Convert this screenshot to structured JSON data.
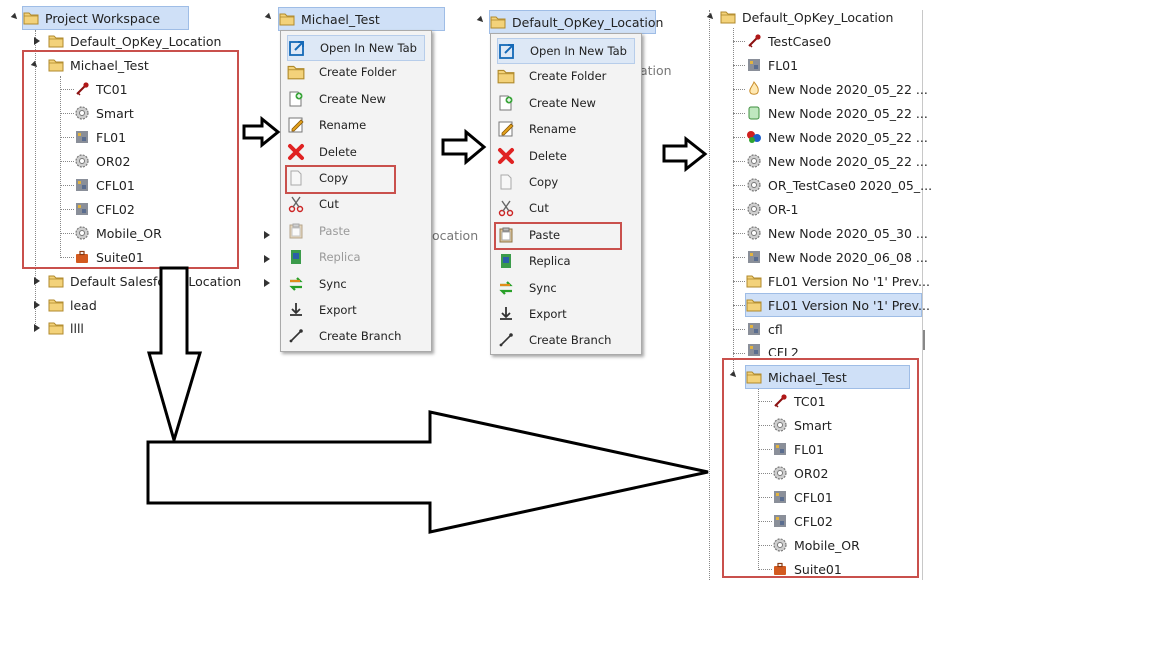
{
  "panel1": {
    "root": "Project Workspace",
    "items": [
      "Default_OpKey_Location",
      "Michael_Test"
    ],
    "children": [
      "TC01",
      "Smart",
      "FL01",
      "OR02",
      "CFL01",
      "CFL02",
      "Mobile_OR",
      "Suite01"
    ],
    "after": [
      "Default Salesforce Location",
      "lead",
      "llll"
    ]
  },
  "menu1": {
    "header": "Michael_Test",
    "items": [
      "Open In New Tab",
      "Create Folder",
      "Create New",
      "Rename",
      "Delete",
      "Copy",
      "Cut",
      "Paste",
      "Replica",
      "Sync",
      "Export",
      "Create Branch"
    ],
    "peek": [
      "cation",
      "ocation"
    ]
  },
  "menu2": {
    "header": "Default_OpKey_Location",
    "items": [
      "Open In New Tab",
      "Create Folder",
      "Create New",
      "Rename",
      "Delete",
      "Copy",
      "Cut",
      "Paste",
      "Replica",
      "Sync",
      "Export",
      "Create Branch"
    ],
    "peek": [
      "ation"
    ]
  },
  "panel4": {
    "root": "Default_OpKey_Location",
    "items": [
      "TestCase0",
      "FL01",
      "New Node 2020_05_22 ...",
      "New Node 2020_05_22 ...",
      "New Node 2020_05_22 ...",
      "New Node 2020_05_22 ...",
      "OR_TestCase0 2020_05_...",
      "OR-1",
      "New Node 2020_05_30 ...",
      "New Node 2020_06_08 ...",
      "FL01 Version No '1' Prev...",
      "FL01 Version No '1' Prev...",
      "cfl",
      "CFL2"
    ],
    "pasted": "Michael_Test",
    "children": [
      "TC01",
      "Smart",
      "FL01",
      "OR02",
      "CFL01",
      "CFL02",
      "Mobile_OR",
      "Suite01"
    ]
  },
  "colors": {
    "highlight_box": "#c9504c",
    "selection": "#cfe0f7",
    "folder": "#f2c94c"
  }
}
